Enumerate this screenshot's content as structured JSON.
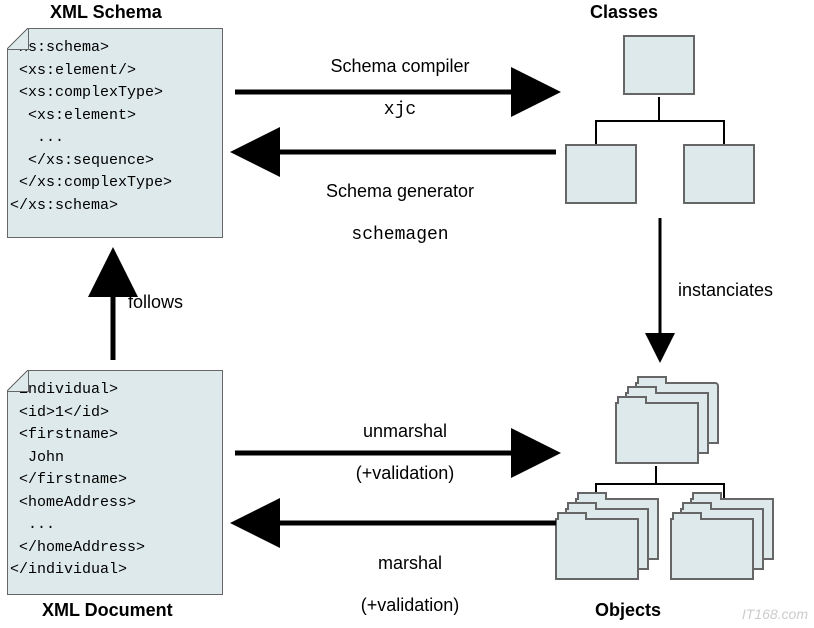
{
  "titles": {
    "schema": "XML Schema",
    "classes": "Classes",
    "document": "XML Document",
    "objects": "Objects"
  },
  "schemaCode": {
    "l1": "<xs:schema>",
    "l2": " <xs:element/>",
    "l3": " <xs:complexType>",
    "l4": "  <xs:element>",
    "l5": "   ...",
    "l6": "  </xs:sequence>",
    "l7": " </xs:complexType>",
    "l8": "</xs:schema>"
  },
  "docCode": {
    "l1": "<individual>",
    "l2": " <id>1</id>",
    "l3": " <firstname>",
    "l4": "  John",
    "l5": " </firstname>",
    "l6": " <homeAddress>",
    "l7": "  ...",
    "l8": " </homeAddress>",
    "l9": "</individual>"
  },
  "arrows": {
    "compiler": {
      "label": "Schema compiler",
      "tool": "xjc"
    },
    "generator": {
      "label": "Schema generator",
      "tool": "schemagen"
    },
    "follows": "follows",
    "instanciates": "instanciates",
    "unmarshal": {
      "label": "unmarshal",
      "note": "(+validation)"
    },
    "marshal": {
      "label": "marshal",
      "note": "(+validation)"
    }
  },
  "watermark": "IT168.com"
}
